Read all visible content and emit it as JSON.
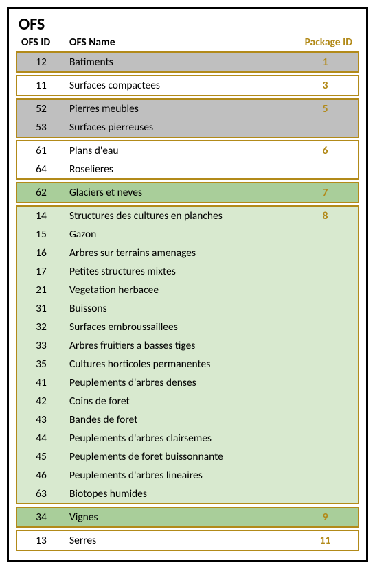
{
  "title": "OFS",
  "headers": {
    "id": "OFS ID",
    "name": "OFS Name",
    "pkg": "Package ID"
  },
  "groups": [
    {
      "style": "grey",
      "pkg": "1",
      "rows": [
        {
          "id": "12",
          "name": "Batiments"
        }
      ]
    },
    {
      "style": "white",
      "pkg": "3",
      "rows": [
        {
          "id": "11",
          "name": "Surfaces compactees"
        }
      ]
    },
    {
      "style": "grey",
      "pkg": "5",
      "rows": [
        {
          "id": "52",
          "name": "Pierres meubles"
        },
        {
          "id": "53",
          "name": "Surfaces pierreuses"
        }
      ]
    },
    {
      "style": "white",
      "pkg": "6",
      "rows": [
        {
          "id": "61",
          "name": "Plans d'eau"
        },
        {
          "id": "64",
          "name": "Roselieres"
        }
      ]
    },
    {
      "style": "greendark",
      "pkg": "7",
      "rows": [
        {
          "id": "62",
          "name": "Glaciers et neves"
        }
      ]
    },
    {
      "style": "greenlight",
      "pkg": "8",
      "rows": [
        {
          "id": "14",
          "name": "Structures des cultures en planches"
        },
        {
          "id": "15",
          "name": "Gazon"
        },
        {
          "id": "16",
          "name": "Arbres sur terrains amenages"
        },
        {
          "id": "17",
          "name": "Petites structures mixtes"
        },
        {
          "id": "21",
          "name": "Vegetation herbacee"
        },
        {
          "id": "31",
          "name": "Buissons"
        },
        {
          "id": "32",
          "name": "Surfaces embroussaillees"
        },
        {
          "id": "33",
          "name": "Arbres fruitiers a basses tiges"
        },
        {
          "id": "35",
          "name": "Cultures horticoles permanentes"
        },
        {
          "id": "41",
          "name": "Peuplements d'arbres denses"
        },
        {
          "id": "42",
          "name": "Coins de foret"
        },
        {
          "id": "43",
          "name": "Bandes de foret"
        },
        {
          "id": "44",
          "name": "Peuplements d'arbres clairsemes"
        },
        {
          "id": "45",
          "name": "Peuplements de foret buissonnante"
        },
        {
          "id": "46",
          "name": "Peuplements d'arbres lineaires"
        },
        {
          "id": "63",
          "name": "Biotopes humides"
        }
      ]
    },
    {
      "style": "greendark",
      "pkg": "9",
      "rows": [
        {
          "id": "34",
          "name": "Vignes"
        }
      ]
    },
    {
      "style": "white",
      "pkg": "11",
      "rows": [
        {
          "id": "13",
          "name": "Serres"
        }
      ]
    }
  ]
}
